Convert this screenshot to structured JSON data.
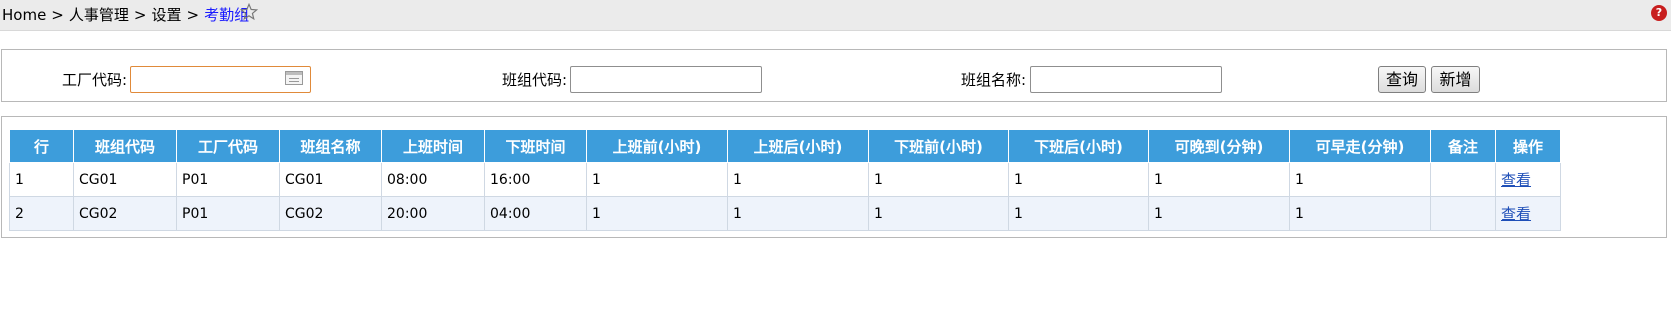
{
  "breadcrumb": {
    "home": "Home",
    "hr": "人事管理",
    "settings": "设置",
    "current": "考勤组",
    "separator": ">"
  },
  "icons": {
    "favorite": "star-icon",
    "help": "help-icon",
    "date_picker": "calendar-icon"
  },
  "help_label": "?",
  "search": {
    "factory_code_label": "工厂代码:",
    "factory_code_value": "",
    "group_code_label": "班组代码:",
    "group_code_value": "",
    "group_name_label": "班组名称:",
    "group_name_value": "",
    "query_button": "查询",
    "add_button": "新增"
  },
  "table": {
    "headers": [
      "行",
      "班组代码",
      "工厂代码",
      "班组名称",
      "上班时间",
      "下班时间",
      "上班前(小时)",
      "上班后(小时)",
      "下班前(小时)",
      "下班后(小时)",
      "可晚到(分钟)",
      "可早走(分钟)",
      "备注",
      "操作"
    ],
    "rows": [
      {
        "row": "1",
        "group_code": "CG01",
        "factory_code": "P01",
        "group_name": "CG01",
        "start": "08:00",
        "end": "16:00",
        "before_start": "1",
        "after_start": "1",
        "before_end": "1",
        "after_end": "1",
        "late_allowed": "1",
        "early_allowed": "1",
        "remark": "",
        "action": "查看"
      },
      {
        "row": "2",
        "group_code": "CG02",
        "factory_code": "P01",
        "group_name": "CG02",
        "start": "20:00",
        "end": "04:00",
        "before_start": "1",
        "after_start": "1",
        "before_end": "1",
        "after_end": "1",
        "late_allowed": "1",
        "early_allowed": "1",
        "remark": "",
        "action": "查看"
      }
    ]
  },
  "colors": {
    "header_bg": "#3d9ddb",
    "link": "#1f4fb8",
    "current_crumb": "#1a1aff",
    "alt_row": "#eef3fb"
  }
}
